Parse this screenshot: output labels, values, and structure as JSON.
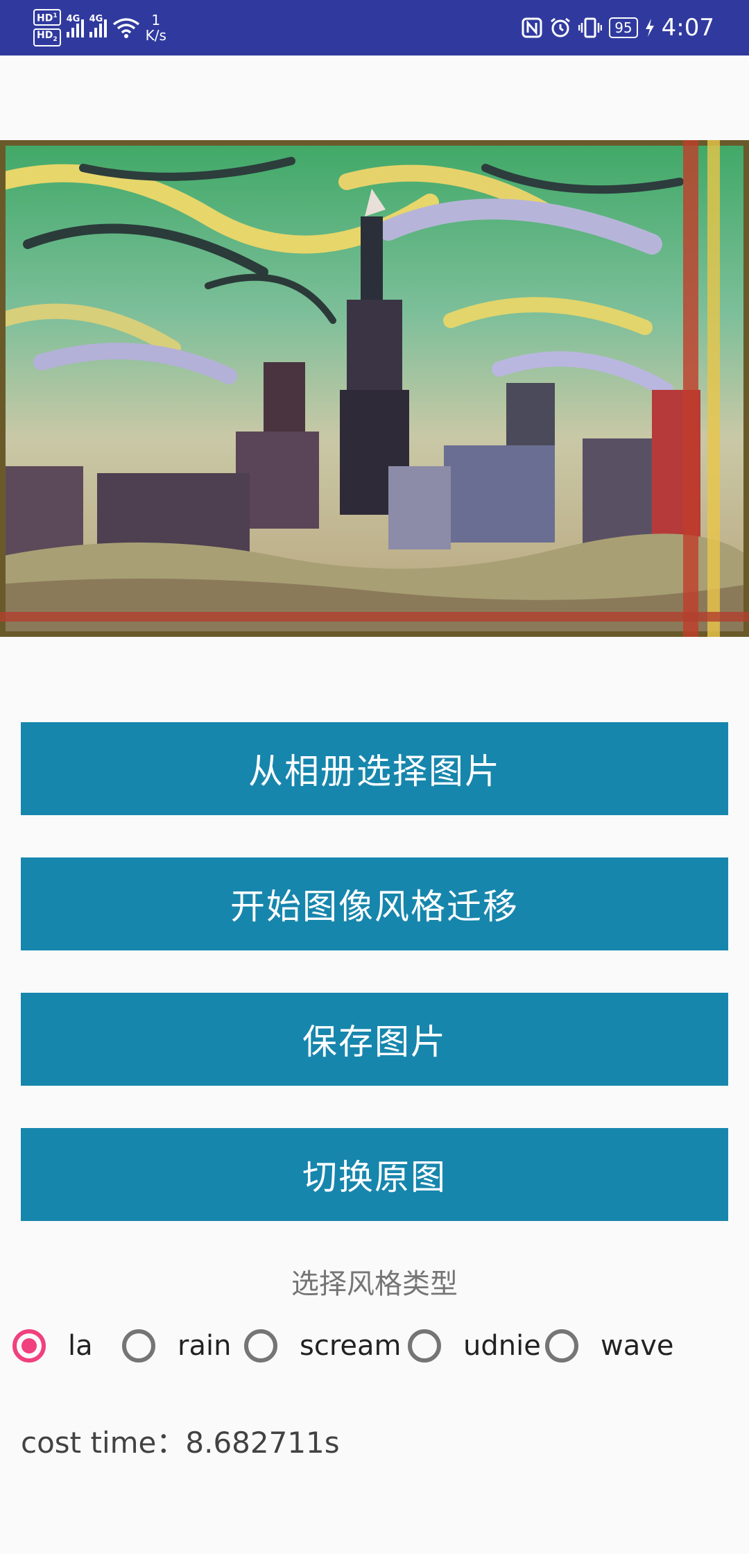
{
  "status_bar": {
    "hd1": "HD",
    "hd1_sub": "1",
    "hd2": "HD",
    "hd2_sub": "2",
    "net1": "4G",
    "net2": "4G",
    "speed_value": "1",
    "speed_unit": "K/s",
    "battery": "95",
    "time": "4:07",
    "icons": [
      "nfc-icon",
      "alarm-icon",
      "vibrate-icon",
      "charging-icon",
      "wifi-icon"
    ]
  },
  "image": {
    "description_icon": "stylized-city-image"
  },
  "buttons": {
    "pick": "从相册选择图片",
    "transfer": "开始图像风格迁移",
    "save": "保存图片",
    "toggle": "切换原图"
  },
  "style_selector": {
    "label": "选择风格类型",
    "options": [
      "la",
      "rain",
      "scream",
      "udnie",
      "wave"
    ],
    "selected": "la"
  },
  "cost": {
    "text": "cost time：8.682711s"
  },
  "colors": {
    "status_bar": "#303a9e",
    "button": "#1786ad",
    "radio_checked": "#f0407e"
  }
}
